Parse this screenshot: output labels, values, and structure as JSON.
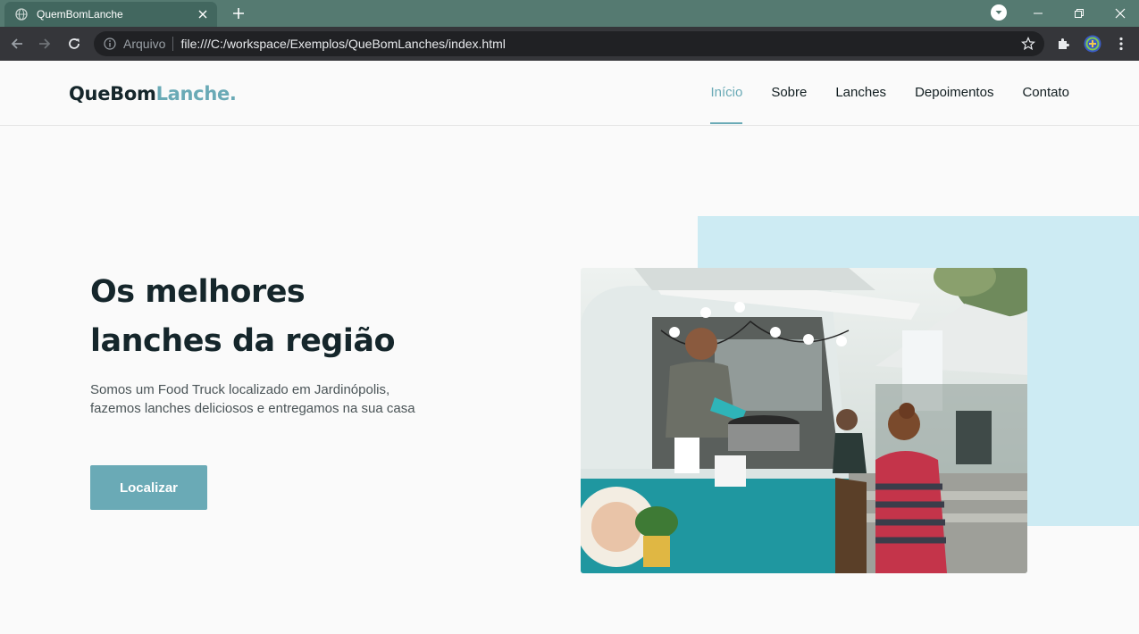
{
  "browser": {
    "tab_title": "QuemBomLanche",
    "scheme_label": "Arquivo",
    "url": "file:///C:/workspace/Exemplos/QueBomLanches/index.html"
  },
  "site": {
    "logo_part1": "QueBom",
    "logo_part2": "Lanche.",
    "nav": [
      {
        "label": "Início",
        "active": true
      },
      {
        "label": "Sobre"
      },
      {
        "label": "Lanches"
      },
      {
        "label": "Depoimentos"
      },
      {
        "label": "Contato"
      }
    ]
  },
  "hero": {
    "title_line1": "Os melhores",
    "title_line2": "lanches da região",
    "description": "Somos um Food Truck localizado em Jardinópolis, fazemos lanches deliciosos e entregamos na sua casa",
    "button_label": "Localizar",
    "image": "food-truck-photo"
  },
  "colors": {
    "accent": "#6aaab6",
    "heading": "#15262b",
    "decor_bg": "#cdebf3",
    "tab_strip": "#557a71"
  }
}
